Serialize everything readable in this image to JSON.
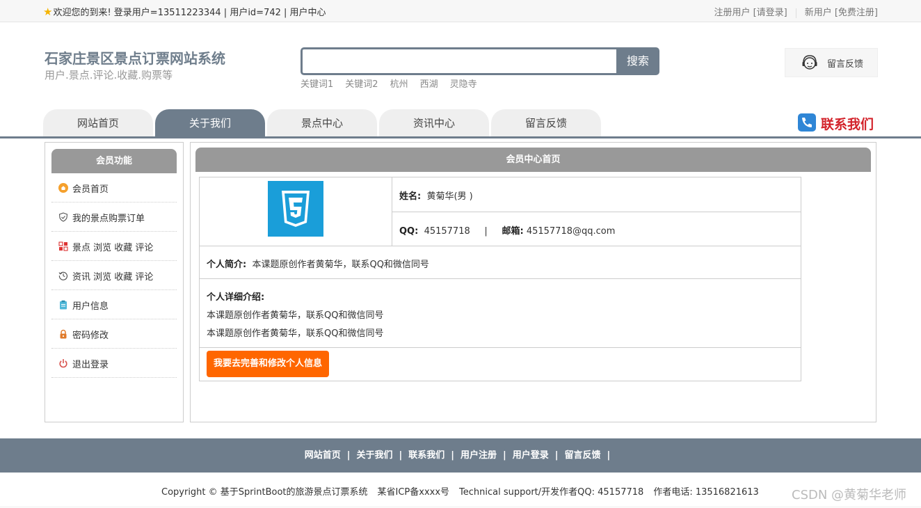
{
  "topbar": {
    "welcome": "欢迎您的到来!  登录用户=13511223344 | 用户id=742 | 用户中心",
    "register_user": "注册用户 [请登录]",
    "new_user": "新用户 [免费注册]"
  },
  "header": {
    "title": "石家庄景区景点订票网站系统",
    "subtitle": "用户.景点.评论.收藏.购票等",
    "search_placeholder": "",
    "search_button": "搜索",
    "hotwords": [
      "关键词1",
      "关键词2",
      "杭州",
      "西湖",
      "灵隐寺"
    ],
    "feedback": "留言反馈"
  },
  "nav": {
    "tabs": [
      "网站首页",
      "关于我们",
      "景点中心",
      "资讯中心",
      "留言反馈"
    ],
    "active_index": 1,
    "contact": "联系我们"
  },
  "sidebar": {
    "title": "会员功能",
    "items": [
      {
        "label": "会员首页",
        "icon": "home-icon"
      },
      {
        "label": "我的景点购票订单",
        "icon": "shield-icon"
      },
      {
        "label": "景点 浏览 收藏 评论",
        "icon": "grid-icon"
      },
      {
        "label": "资讯 浏览 收藏 评论",
        "icon": "history-icon"
      },
      {
        "label": "用户信息",
        "icon": "clipboard-icon"
      },
      {
        "label": "密码修改",
        "icon": "lock-icon"
      },
      {
        "label": "退出登录",
        "icon": "power-icon"
      }
    ]
  },
  "main": {
    "title": "会员中心首页",
    "profile": {
      "name_label": "姓名:",
      "name_value": "黄菊华(男 )",
      "qq_label": "QQ:",
      "qq_value": "45157718",
      "separator": "|",
      "email_label": "邮箱:",
      "email_value": "45157718@qq.com",
      "intro_label": "个人简介:",
      "intro_value": "本课题原创作者黄菊华，联系QQ和微信同号",
      "detail_label": "个人详细介绍:",
      "detail_lines": [
        "本课题原创作者黄菊华，联系QQ和微信同号",
        "本课题原创作者黄菊华，联系QQ和微信同号"
      ],
      "edit_button": "我要去完善和修改个人信息"
    }
  },
  "footer": {
    "links": [
      "网站首页",
      "关于我们",
      "联系我们",
      "用户注册",
      "用户登录",
      "留言反馈"
    ],
    "copyright": "Copyright © 基于SprintBoot的旅游景点订票系统",
    "icp": "某省ICP备xxxx号",
    "support": "Technical support/开发作者QQ: 45157718",
    "phone": "作者电话: 13516821613",
    "watermark": "CSDN @黄菊华老师"
  },
  "colors": {
    "accent": "#6e7d8c",
    "button_orange": "#ff6600",
    "contact_red": "#d3222a",
    "panel_header": "#999999"
  }
}
